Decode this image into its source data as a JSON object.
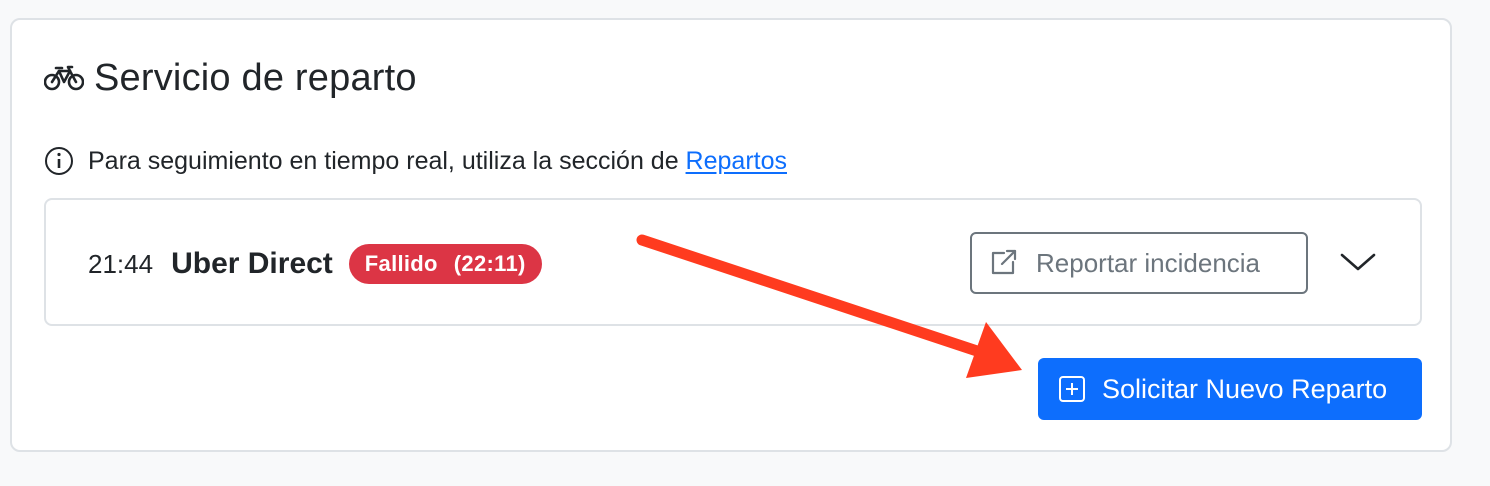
{
  "card": {
    "title": "Servicio de reparto",
    "title_icon": "bicycle-icon"
  },
  "info": {
    "text": "Para seguimiento en tiempo real, utiliza la sección de ",
    "link_label": "Repartos",
    "icon": "info-circle-icon"
  },
  "delivery": {
    "time": "21:44",
    "provider": "Uber Direct",
    "status": {
      "label": "Fallido",
      "time": "(22:11)",
      "color": "#dc3545"
    },
    "report_button": {
      "label": "Reportar incidencia",
      "icon": "external-link-icon"
    },
    "expand_icon": "chevron-down-icon"
  },
  "new_delivery_button": {
    "label": "Solicitar Nuevo Reparto",
    "icon": "plus-square-icon",
    "color": "#0d6efd"
  },
  "annotation": {
    "type": "arrow",
    "color": "#ff3b1f"
  }
}
